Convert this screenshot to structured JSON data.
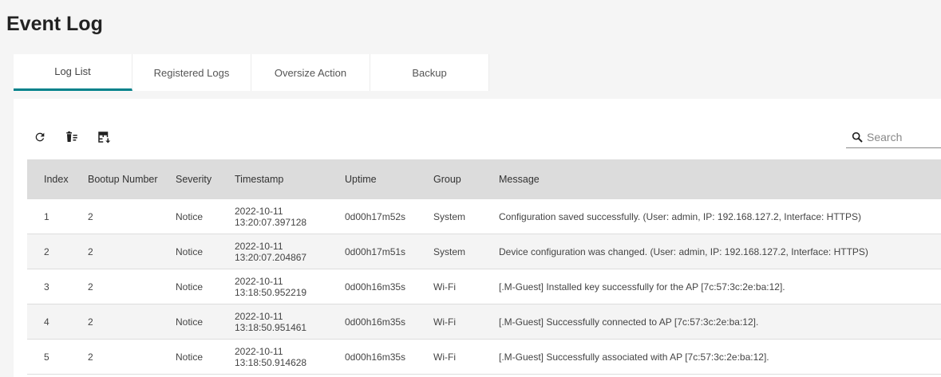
{
  "page": {
    "title": "Event Log"
  },
  "tabs": [
    {
      "label": "Log List",
      "active": true
    },
    {
      "label": "Registered Logs",
      "active": false
    },
    {
      "label": "Oversize Action",
      "active": false
    },
    {
      "label": "Backup",
      "active": false
    }
  ],
  "toolbar": {
    "icons": [
      "refresh-icon",
      "clear-log-icon",
      "export-table-icon"
    ]
  },
  "search": {
    "placeholder": "Search",
    "value": ""
  },
  "table": {
    "columns": [
      "Index",
      "Bootup Number",
      "Severity",
      "Timestamp",
      "Uptime",
      "Group",
      "Message"
    ],
    "rows": [
      {
        "index": "1",
        "bootup": "2",
        "severity": "Notice",
        "ts_date": "2022-10-11",
        "ts_time": "13:20:07.397128",
        "uptime": "0d00h17m52s",
        "group": "System",
        "message": "Configuration saved successfully. (User: admin, IP: 192.168.127.2, Interface: HTTPS)"
      },
      {
        "index": "2",
        "bootup": "2",
        "severity": "Notice",
        "ts_date": "2022-10-11",
        "ts_time": "13:20:07.204867",
        "uptime": "0d00h17m51s",
        "group": "System",
        "message": "Device configuration was changed. (User: admin, IP: 192.168.127.2, Interface: HTTPS)"
      },
      {
        "index": "3",
        "bootup": "2",
        "severity": "Notice",
        "ts_date": "2022-10-11",
        "ts_time": "13:18:50.952219",
        "uptime": "0d00h16m35s",
        "group": "Wi-Fi",
        "message": "[.M-Guest] Installed key successfully for the AP [7c:57:3c:2e:ba:12]."
      },
      {
        "index": "4",
        "bootup": "2",
        "severity": "Notice",
        "ts_date": "2022-10-11",
        "ts_time": "13:18:50.951461",
        "uptime": "0d00h16m35s",
        "group": "Wi-Fi",
        "message": "[.M-Guest] Successfully connected to AP [7c:57:3c:2e:ba:12]."
      },
      {
        "index": "5",
        "bootup": "2",
        "severity": "Notice",
        "ts_date": "2022-10-11",
        "ts_time": "13:18:50.914628",
        "uptime": "0d00h16m35s",
        "group": "Wi-Fi",
        "message": "[.M-Guest] Successfully associated with AP [7c:57:3c:2e:ba:12]."
      }
    ]
  },
  "colors": {
    "accent": "#00818a",
    "header_bg": "#dcdcdc",
    "page_bg": "#f5f5f5"
  }
}
